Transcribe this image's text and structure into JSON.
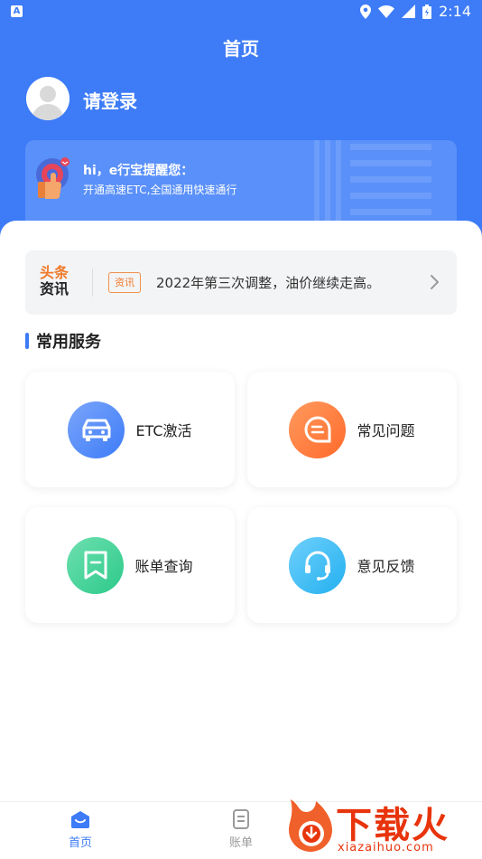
{
  "status_bar": {
    "time": "2:14"
  },
  "header": {
    "title": "首页"
  },
  "user": {
    "login_prompt": "请登录"
  },
  "reminder": {
    "title": "hi，e行宝提醒您：",
    "subtitle": "开通高速ETC,全国通用快速通行"
  },
  "news": {
    "logo_line1": "头条",
    "logo_line2": "资讯",
    "tag": "资讯",
    "headline": "2022年第三次调整，油价继续走高。"
  },
  "services": {
    "section_title": "常用服务",
    "items": [
      {
        "label": "ETC激活",
        "icon": "car-icon",
        "color_from": "#7aa6fb",
        "color_to": "#3d7bf7"
      },
      {
        "label": "常见问题",
        "icon": "chat-icon",
        "color_from": "#ff9a5e",
        "color_to": "#ff6a2b"
      },
      {
        "label": "账单查询",
        "icon": "bill-icon",
        "color_from": "#6ee0b0",
        "color_to": "#2cc98a"
      },
      {
        "label": "意见反馈",
        "icon": "headset-icon",
        "color_from": "#6fd0fb",
        "color_to": "#23b0f0"
      }
    ]
  },
  "tabs": [
    {
      "label": "首页",
      "icon": "home-icon",
      "active": true
    },
    {
      "label": "账单",
      "icon": "bill-tab-icon",
      "active": false
    }
  ],
  "colors": {
    "primary": "#3d7bf7",
    "inactive": "#9a9a9a",
    "watermark": "#e8340c"
  },
  "watermark": {
    "brand": "下载火",
    "url": "xiazaihuo.com"
  }
}
